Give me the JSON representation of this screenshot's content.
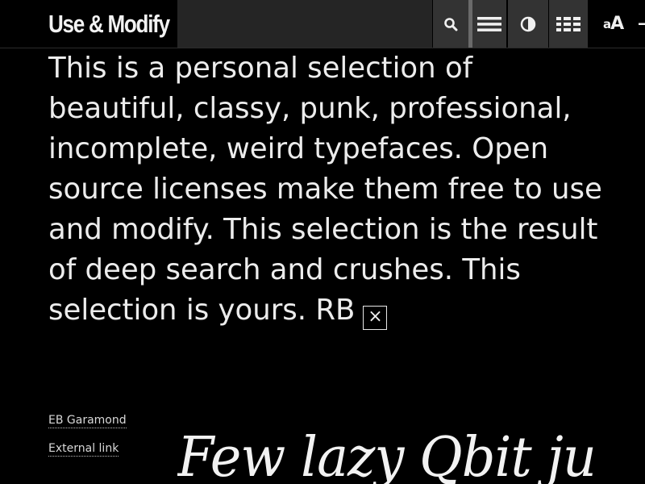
{
  "header": {
    "logo_text": "Use & Modify",
    "search": {
      "value": "",
      "placeholder": ""
    },
    "buttons": {
      "search_icon": "search-icon",
      "menu_icon": "list-icon",
      "contrast_icon": "contrast-icon",
      "grid_icon": "grid-icon",
      "font_size_small": "a",
      "font_size_large": "A",
      "minus_icon": "minus-icon"
    }
  },
  "intro": {
    "text": "This is a personal selection of beautiful, classy, punk, professional, incomplete, weird typefaces. Open source licenses make them free to use and modify. This selection is the result of deep search and crushes. This selection is yours. RB",
    "close_glyph": "×"
  },
  "font_entry": {
    "name": "EB Garamond",
    "external_link_label": "External link",
    "specimen_text": "Few lazy Qbit jumps over the dog"
  },
  "colors": {
    "background": "#000000",
    "text": "#ececec",
    "toolbar_button": "#333333",
    "search_field": "#252525"
  }
}
